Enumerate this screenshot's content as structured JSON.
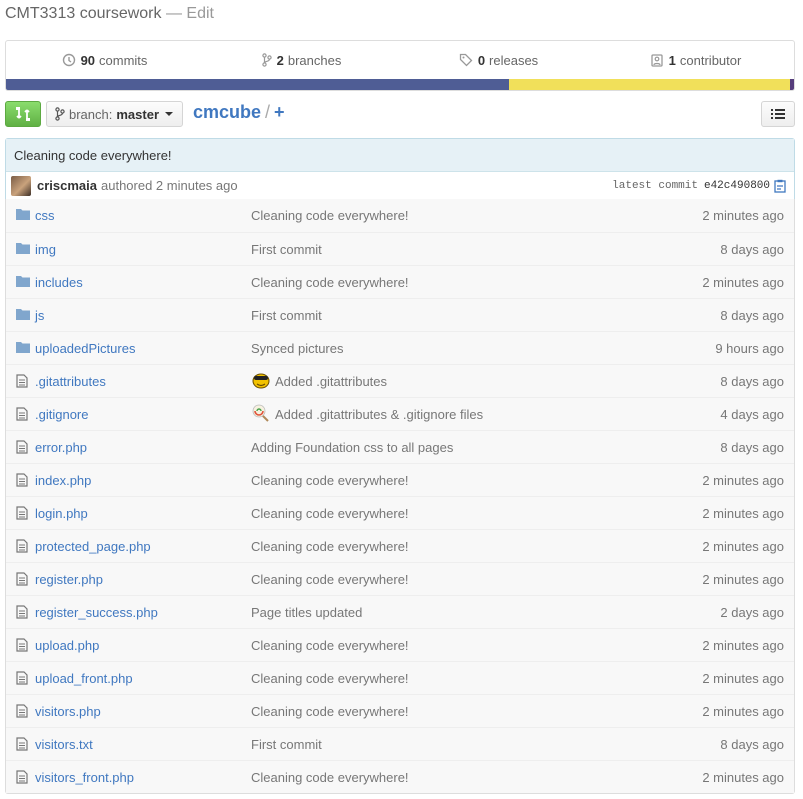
{
  "repo": {
    "description": "CMT3313 coursework",
    "edit_label": "— Edit"
  },
  "stats": {
    "commits": {
      "count": "90",
      "label": "commits"
    },
    "branches": {
      "count": "2",
      "label": "branches"
    },
    "releases": {
      "count": "0",
      "label": "releases"
    },
    "contributors": {
      "count": "1",
      "label": "contributor"
    },
    "languages_colors": [
      "#4f5d95",
      "#f1e05a",
      "#563d7c"
    ]
  },
  "toolbar": {
    "branch_prefix": "branch:",
    "branch_name": "master",
    "path_root": "cmcube",
    "path_sep": "/",
    "path_add": "+"
  },
  "commit": {
    "message": "Cleaning code everywhere!",
    "author": "criscmaia",
    "authored_text": "authored 2 minutes ago",
    "latest_label": "latest commit",
    "sha": "e42c490800"
  },
  "files": [
    {
      "name": "css",
      "type": "dir",
      "message": "Cleaning code everywhere!",
      "age": "2 minutes ago"
    },
    {
      "name": "img",
      "type": "dir",
      "message": "First commit",
      "age": "8 days ago"
    },
    {
      "name": "includes",
      "type": "dir",
      "message": "Cleaning code everywhere!",
      "age": "2 minutes ago"
    },
    {
      "name": "js",
      "type": "dir",
      "message": "First commit",
      "age": "8 days ago"
    },
    {
      "name": "uploadedPictures",
      "type": "dir",
      "message": "Synced pictures",
      "age": "9 hours ago"
    },
    {
      "name": ".gitattributes",
      "type": "file",
      "message": "Added .gitattributes",
      "emoji": "emoji-face",
      "age": "8 days ago"
    },
    {
      "name": ".gitignore",
      "type": "file",
      "message": "Added .gitattributes & .gitignore files",
      "emoji": "emoji-lollipop",
      "age": "4 days ago"
    },
    {
      "name": "error.php",
      "type": "file",
      "message": "Adding Foundation css to all pages",
      "age": "8 days ago"
    },
    {
      "name": "index.php",
      "type": "file",
      "message": "Cleaning code everywhere!",
      "age": "2 minutes ago"
    },
    {
      "name": "login.php",
      "type": "file",
      "message": "Cleaning code everywhere!",
      "age": "2 minutes ago"
    },
    {
      "name": "protected_page.php",
      "type": "file",
      "message": "Cleaning code everywhere!",
      "age": "2 minutes ago"
    },
    {
      "name": "register.php",
      "type": "file",
      "message": "Cleaning code everywhere!",
      "age": "2 minutes ago"
    },
    {
      "name": "register_success.php",
      "type": "file",
      "message": "Page titles updated",
      "age": "2 days ago"
    },
    {
      "name": "upload.php",
      "type": "file",
      "message": "Cleaning code everywhere!",
      "age": "2 minutes ago"
    },
    {
      "name": "upload_front.php",
      "type": "file",
      "message": "Cleaning code everywhere!",
      "age": "2 minutes ago"
    },
    {
      "name": "visitors.php",
      "type": "file",
      "message": "Cleaning code everywhere!",
      "age": "2 minutes ago"
    },
    {
      "name": "visitors.txt",
      "type": "file",
      "message": "First commit",
      "age": "8 days ago"
    },
    {
      "name": "visitors_front.php",
      "type": "file",
      "message": "Cleaning code everywhere!",
      "age": "2 minutes ago"
    }
  ]
}
